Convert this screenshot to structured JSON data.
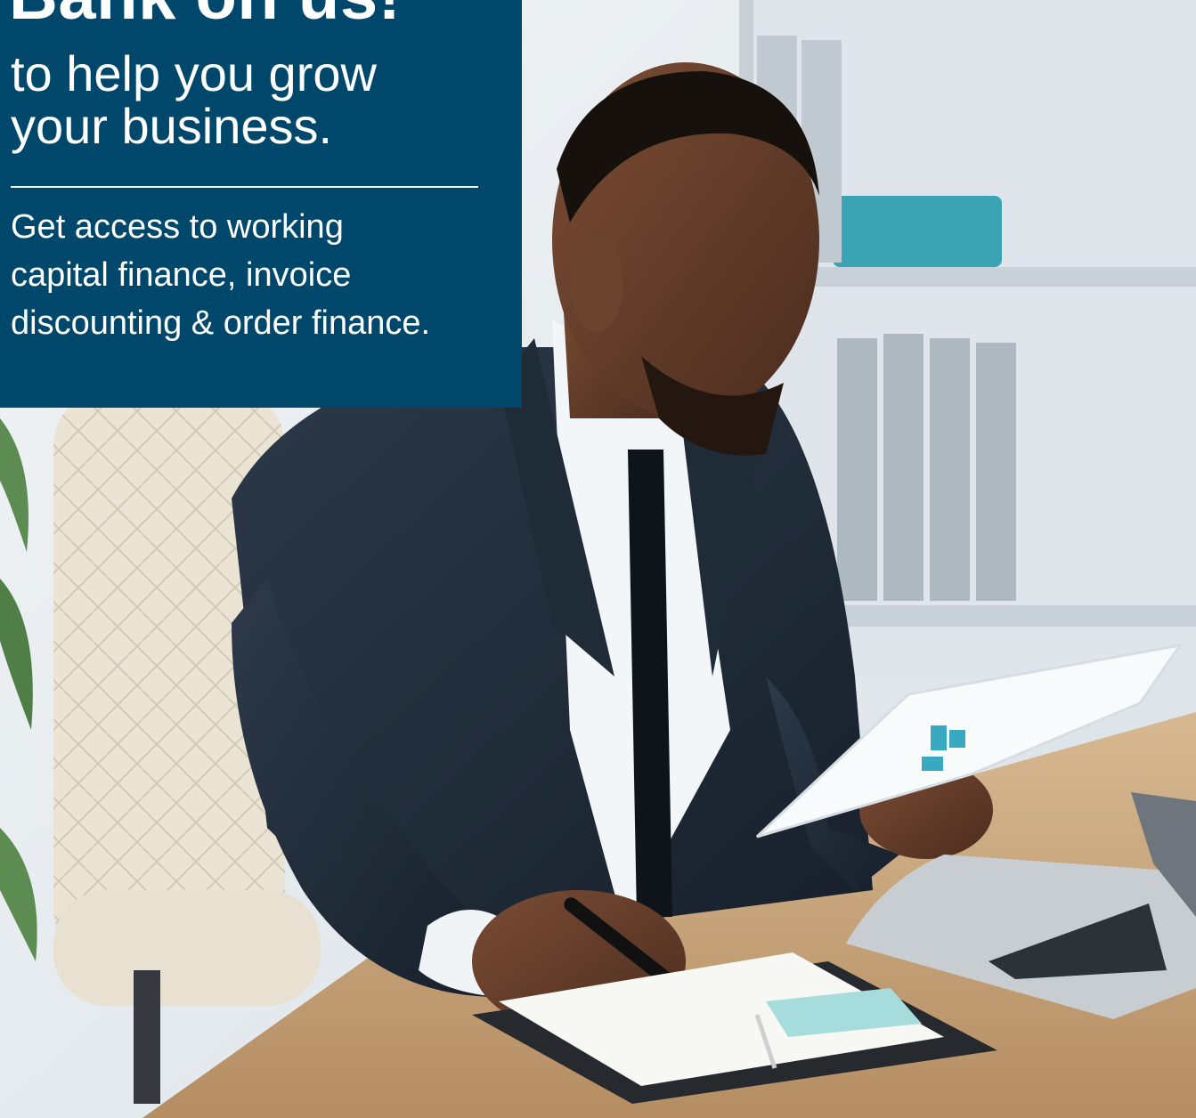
{
  "ad": {
    "headline": "Bank on us!",
    "subheadline_line1": "to help you grow",
    "subheadline_line2": "your business.",
    "body_line1": "Get access to working",
    "body_line2": "capital finance, invoice",
    "body_line3": "discounting & order finance."
  },
  "colors": {
    "panel": "#00486b",
    "panel_text": "#ffffff",
    "suit": "#1f2b3a",
    "desk": "#c9a77f",
    "chair": "#ece4d6"
  },
  "photo_subjects": [
    "businessman-in-suit",
    "office-chair",
    "bookshelf",
    "desk",
    "laptop",
    "notebook",
    "papers",
    "pen",
    "plant"
  ]
}
